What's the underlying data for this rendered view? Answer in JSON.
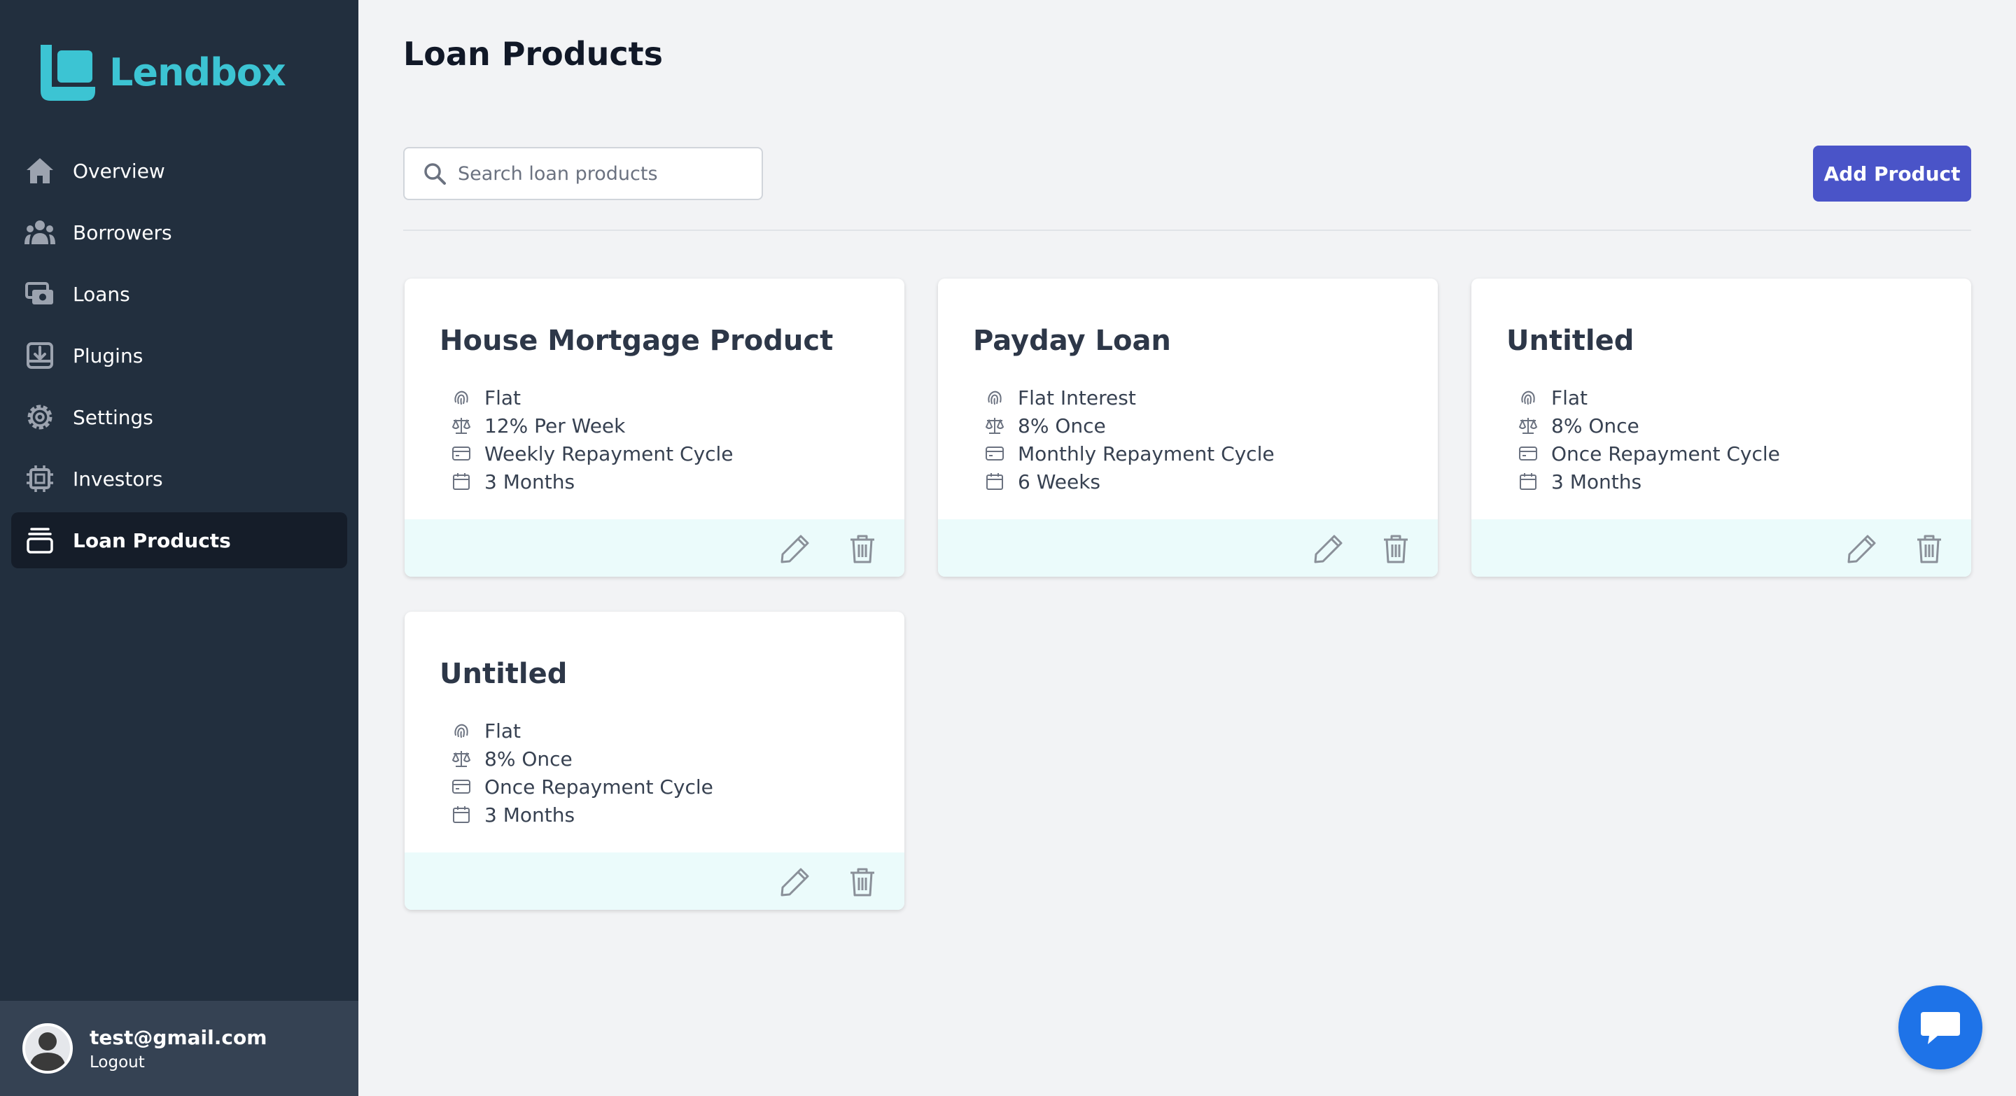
{
  "brand": {
    "name": "Lendbox",
    "accent": "#3cc4d3"
  },
  "sidebar": {
    "items": [
      {
        "label": "Overview",
        "icon": "home-icon",
        "active": false
      },
      {
        "label": "Borrowers",
        "icon": "users-icon",
        "active": false
      },
      {
        "label": "Loans",
        "icon": "cash-icon",
        "active": false
      },
      {
        "label": "Plugins",
        "icon": "download-tray-icon",
        "active": false
      },
      {
        "label": "Settings",
        "icon": "gear-icon",
        "active": false
      },
      {
        "label": "Investors",
        "icon": "chip-icon",
        "active": false
      },
      {
        "label": "Loan Products",
        "icon": "archive-icon",
        "active": true
      }
    ],
    "user": {
      "email": "test@gmail.com",
      "logout_label": "Logout"
    }
  },
  "main": {
    "title": "Loan Products",
    "search": {
      "placeholder": "Search loan products",
      "value": ""
    },
    "add_button_label": "Add Product",
    "products": [
      {
        "name": "House Mortgage Product",
        "interest_type": "Flat",
        "rate": "12% Per Week",
        "cycle": "Weekly Repayment Cycle",
        "duration": "3 Months"
      },
      {
        "name": "Payday Loan",
        "interest_type": "Flat Interest",
        "rate": "8% Once",
        "cycle": "Monthly Repayment Cycle",
        "duration": "6 Weeks"
      },
      {
        "name": "Untitled",
        "interest_type": "Flat",
        "rate": "8% Once",
        "cycle": "Once Repayment Cycle",
        "duration": "3 Months"
      },
      {
        "name": "Untitled",
        "interest_type": "Flat",
        "rate": "8% Once",
        "cycle": "Once Repayment Cycle",
        "duration": "3 Months"
      }
    ]
  },
  "colors": {
    "sidebar_bg": "#222f3e",
    "primary_button": "#4a54c8",
    "card_footer": "#ebfbfb",
    "chat_button": "#1e73e8"
  }
}
